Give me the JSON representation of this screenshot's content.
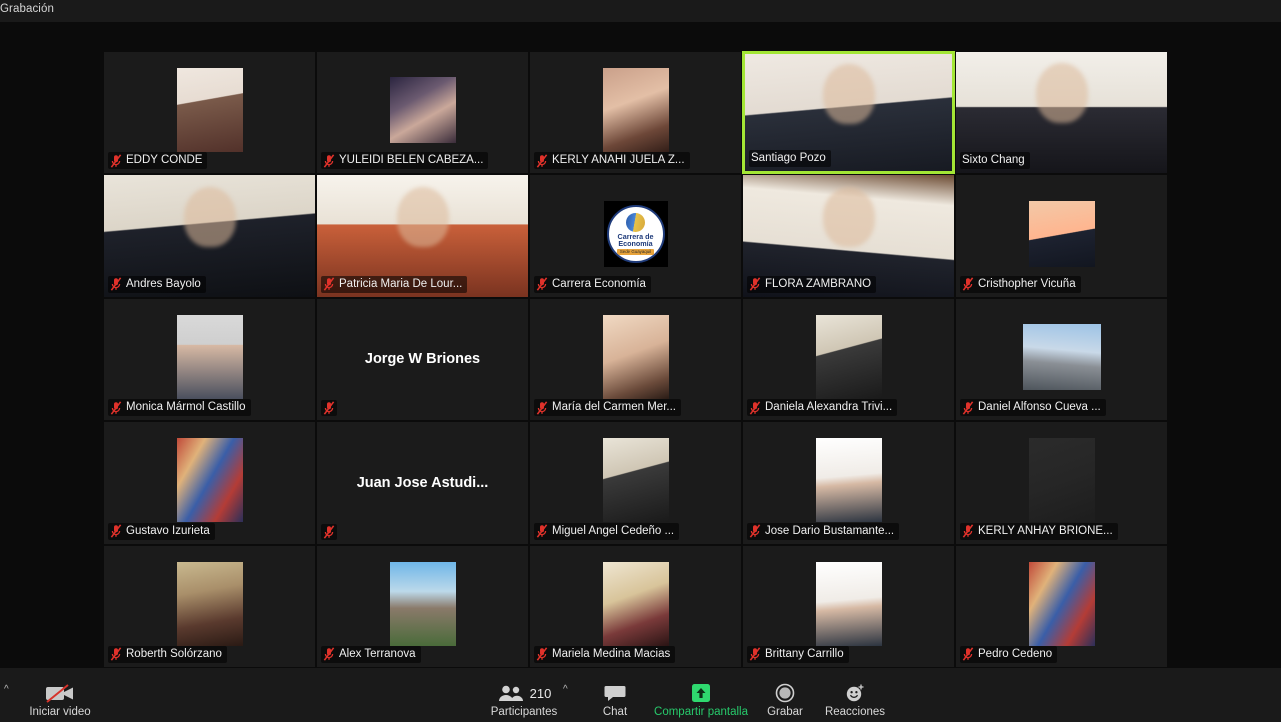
{
  "app": {
    "recording_label": "Grabación"
  },
  "speaker": {
    "active_name": "Santiago Pozo",
    "border_color": "#a3e635"
  },
  "participants": [
    {
      "name": "EDDY CONDE",
      "muted": true,
      "video": false,
      "style": "avatar",
      "art": "g1",
      "shape": "tall"
    },
    {
      "name": "YULEIDI BELEN CABEZA...",
      "muted": true,
      "video": false,
      "style": "avatar",
      "art": "g2",
      "shape": "sq"
    },
    {
      "name": "KERLY ANAHI JUELA Z...",
      "muted": true,
      "video": false,
      "style": "avatar",
      "art": "g3",
      "shape": "tall"
    },
    {
      "name": "Santiago Pozo",
      "muted": false,
      "video": true,
      "style": "feed",
      "art": "feed-a",
      "shape": "full"
    },
    {
      "name": "Sixto Chang",
      "muted": false,
      "video": true,
      "style": "feed",
      "art": "feed-c",
      "shape": "full"
    },
    {
      "name": "Andres Bayolo",
      "muted": true,
      "video": true,
      "style": "feed",
      "art": "feed-e",
      "shape": "full"
    },
    {
      "name": "Patricia Maria De Lour...",
      "muted": true,
      "video": true,
      "style": "feed",
      "art": "feed-b",
      "shape": "full"
    },
    {
      "name": "Carrera Economía",
      "muted": true,
      "video": false,
      "style": "logo",
      "art": "logo",
      "shape": "sq"
    },
    {
      "name": "FLORA ZAMBRANO",
      "muted": true,
      "video": true,
      "style": "feed",
      "art": "feed-d",
      "shape": "full"
    },
    {
      "name": "Cristhopher Vicuña",
      "muted": true,
      "video": false,
      "style": "avatar",
      "art": "g4",
      "shape": "sq"
    },
    {
      "name": "Monica Mármol Castillo",
      "muted": true,
      "video": false,
      "style": "avatar",
      "art": "g5",
      "shape": "tall"
    },
    {
      "name": "Jorge W Briones",
      "muted": true,
      "video": false,
      "style": "bigname",
      "art": "",
      "shape": "none"
    },
    {
      "name": "María del Carmen Mer...",
      "muted": true,
      "video": false,
      "style": "avatar",
      "art": "g6",
      "shape": "tall"
    },
    {
      "name": "Daniela Alexandra Trivi...",
      "muted": true,
      "video": false,
      "style": "avatar",
      "art": "g7",
      "shape": "tall"
    },
    {
      "name": "Daniel Alfonso Cueva ...",
      "muted": true,
      "video": false,
      "style": "avatar",
      "art": "g8",
      "shape": "wide"
    },
    {
      "name": "Gustavo Izurieta",
      "muted": true,
      "video": false,
      "style": "avatar",
      "art": "g12",
      "shape": "tall"
    },
    {
      "name": "Juan Jose Astudi...",
      "muted": true,
      "video": false,
      "style": "bigname",
      "art": "",
      "shape": "none"
    },
    {
      "name": "Miguel Angel Cedeño ...",
      "muted": true,
      "video": false,
      "style": "avatar",
      "art": "g7",
      "shape": "tall"
    },
    {
      "name": "Jose Dario Bustamante...",
      "muted": true,
      "video": false,
      "style": "avatar",
      "art": "g11",
      "shape": "tall"
    },
    {
      "name": "KERLY ANHAY BRIONE...",
      "muted": true,
      "video": false,
      "style": "avatar",
      "art": "g9",
      "shape": "tall"
    },
    {
      "name": "Roberth Solórzano",
      "muted": true,
      "video": false,
      "style": "avatar",
      "art": "g10",
      "shape": "tall"
    },
    {
      "name": "Alex Terranova",
      "muted": true,
      "video": false,
      "style": "avatar",
      "art": "g13",
      "shape": "tall"
    },
    {
      "name": "Mariela Medina Macias",
      "muted": true,
      "video": false,
      "style": "avatar",
      "art": "g14",
      "shape": "tall"
    },
    {
      "name": "Brittany Carrillo",
      "muted": true,
      "video": false,
      "style": "avatar",
      "art": "g11",
      "shape": "tall"
    },
    {
      "name": "Pedro Cedeno",
      "muted": true,
      "video": false,
      "style": "avatar",
      "art": "g12",
      "shape": "tall"
    }
  ],
  "logo_tile": {
    "line1": "Carrera de",
    "line2": "Economía",
    "line3": "Sede Guayaquil"
  },
  "toolbar": {
    "start_video_label": "Iniciar video",
    "participants_label": "Participantes",
    "participants_count": "210",
    "chat_label": "Chat",
    "share_label": "Compartir pantalla",
    "record_label": "Grabar",
    "reactions_label": "Reacciones",
    "share_color": "#27c96b"
  }
}
